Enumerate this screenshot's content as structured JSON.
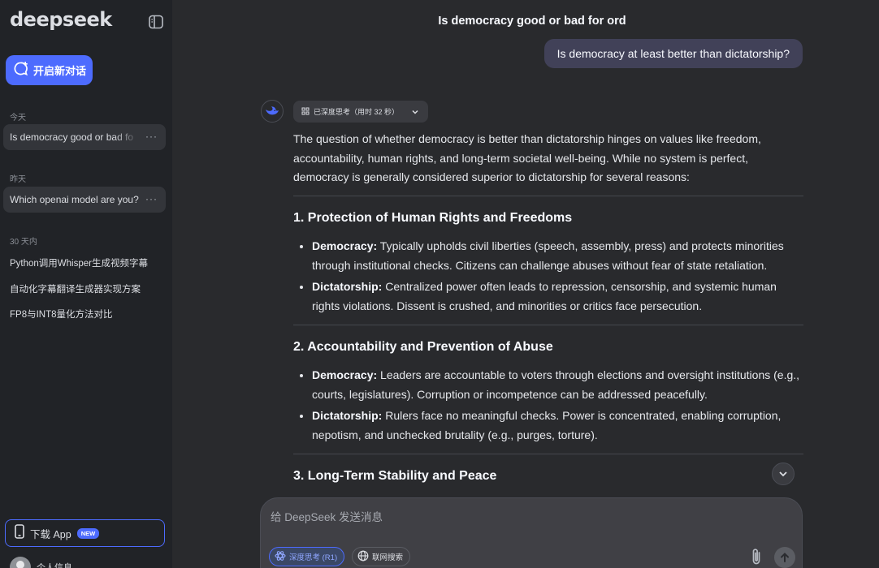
{
  "sidebar": {
    "logo": "deepseek",
    "new_chat_label": "开启新对话",
    "sections": [
      {
        "label": "今天",
        "items": [
          "Is democracy good or bad fo"
        ]
      },
      {
        "label": "昨天",
        "items": [
          "Which openai model are you?"
        ]
      },
      {
        "label": "30 天内",
        "items": [
          "Python调用Whisper生成视频字幕",
          "自动化字幕翻译生成器实现方案",
          "FP8与INT8量化方法对比"
        ]
      }
    ],
    "download_label": "下载 App",
    "download_badge": "NEW",
    "profile_label": "个人信息"
  },
  "chat": {
    "title": "Is democracy good or bad for ord",
    "user_message": "Is democracy at least better than dictatorship?",
    "thinking_label": "已深度思考（用时 32 秒）",
    "intro": "The question of whether democracy is better than dictatorship hinges on values like freedom, accountability, human rights, and long-term societal well-being. While no system is perfect, democracy is generally considered superior to dictatorship for several reasons:",
    "sections": [
      {
        "heading": "1. Protection of Human Rights and Freedoms",
        "points": [
          {
            "term": "Democracy:",
            "text": "Typically upholds civil liberties (speech, assembly, press) and protects minorities through institutional checks. Citizens can challenge abuses without fear of state retaliation."
          },
          {
            "term": "Dictatorship:",
            "text": "Centralized power often leads to repression, censorship, and systemic human rights violations. Dissent is crushed, and minorities or critics face persecution."
          }
        ]
      },
      {
        "heading": "2. Accountability and Prevention of Abuse",
        "points": [
          {
            "term": "Democracy:",
            "text": "Leaders are accountable to voters through elections and oversight institutions (e.g., courts, legislatures). Corruption or incompetence can be addressed peacefully."
          },
          {
            "term": "Dictatorship:",
            "text": "Rulers face no meaningful checks. Power is concentrated, enabling corruption, nepotism, and unchecked brutality (e.g., purges, torture)."
          }
        ]
      },
      {
        "heading": "3. Long-Term Stability and Peace"
      }
    ]
  },
  "composer": {
    "placeholder": "给 DeepSeek 发送消息",
    "deep_think_label": "深度思考 (R1)",
    "search_label": "联网搜索"
  },
  "colors": {
    "accent": "#4d6bfe",
    "sidebar_bg": "#212327",
    "main_bg": "#292a2d",
    "user_bubble": "#414158"
  }
}
